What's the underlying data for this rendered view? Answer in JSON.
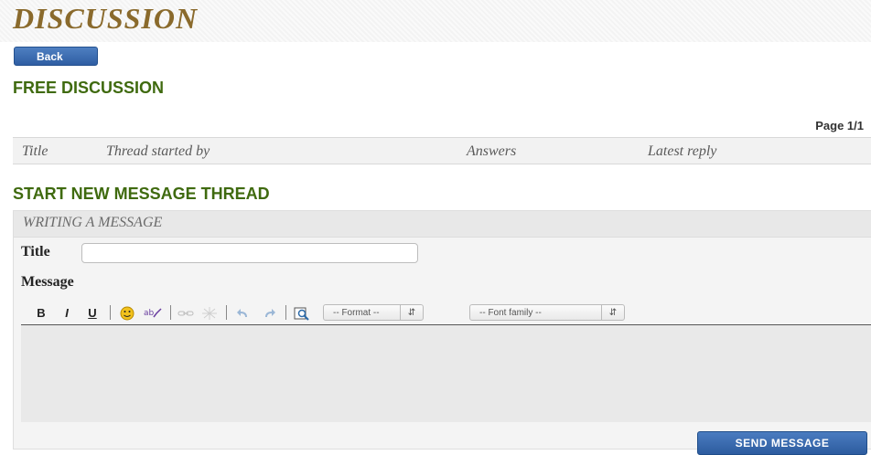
{
  "header": {
    "title": "DISCUSSION"
  },
  "nav": {
    "back_label": "Back"
  },
  "forum": {
    "title": "FREE DISCUSSION",
    "page_indicator": "Page 1/1",
    "columns": [
      "Title",
      "Thread started by",
      "Answers",
      "Latest reply"
    ]
  },
  "new_thread": {
    "heading": "START NEW MESSAGE THREAD",
    "panel_title": "WRITING A MESSAGE",
    "title_label": "Title",
    "title_value": "",
    "message_label": "Message",
    "toolbar": {
      "bold": "B",
      "italic": "I",
      "underline": "U",
      "format_select": "-- Format --",
      "font_select": "-- Font family --"
    },
    "icons": [
      "bold-icon",
      "italic-icon",
      "underline-icon",
      "emoticon-icon",
      "spellcheck-icon",
      "link-icon",
      "unlink-icon",
      "undo-icon",
      "redo-icon",
      "preview-icon"
    ],
    "send_label": "SEND MESSAGE"
  }
}
